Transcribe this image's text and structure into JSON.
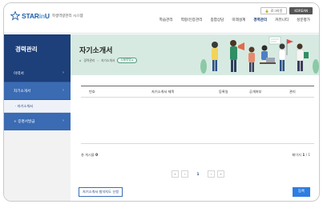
{
  "header": {
    "logo": {
      "star": "STAR",
      "in": "in",
      "u": "U",
      "sub": "학생역량관리 시스템"
    },
    "top_buttons": {
      "login": "로그아웃",
      "user": "KOREAN"
    },
    "nav": [
      "학습관리",
      "역량/인증관리",
      "종합상담",
      "미래설계",
      "경력관리",
      "커뮤니티",
      "성문평가"
    ],
    "active_nav": "경력관리"
  },
  "sidebar": {
    "title": "경력관리",
    "items": [
      {
        "label": "이력서"
      },
      {
        "label": "자기소개서"
      }
    ],
    "sub_item": "· 자기소개서",
    "last_item": "+ 증명서발급"
  },
  "banner": {
    "title": "자기소개서",
    "crumbs": [
      "⌂",
      "경력관리",
      "자기소개서"
    ],
    "badge": "사용방법 ▸",
    "bg_color": "#d7eae2"
  },
  "table": {
    "headers": [
      "번호",
      "자기소개서 제목",
      "등록일",
      "공개여부",
      "관리"
    ],
    "rows": []
  },
  "footer": {
    "total_label": "총 게시물",
    "total_count": "0",
    "page_label": "페이지",
    "page_current": "1",
    "page_total": "/ 1",
    "pager": [
      "«",
      "‹",
      "1",
      "›",
      "»"
    ],
    "apply_button": "자기소개서 첨삭지도 신청",
    "register_button": "등록"
  },
  "colors": {
    "primary": "#1d3f7a",
    "accent": "#2f7de1",
    "sidebar_light": "#3a6bb3"
  }
}
